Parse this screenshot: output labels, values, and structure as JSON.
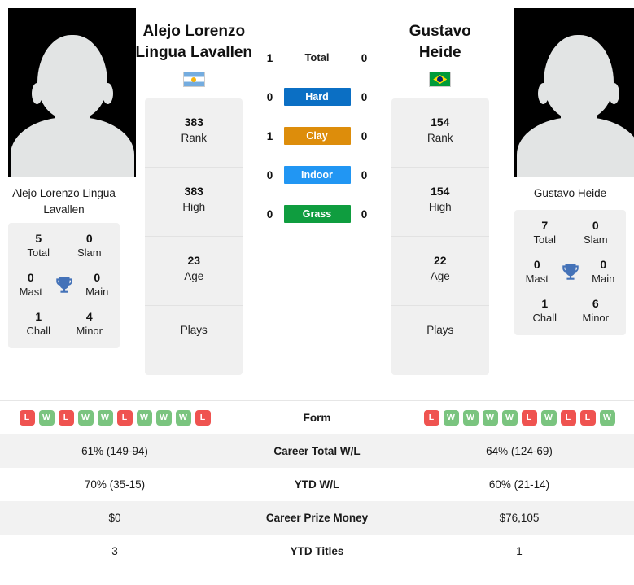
{
  "players": {
    "left": {
      "display_name": "Alejo Lorenzo\nLingua Lavallen",
      "name_line1": "Alejo Lorenzo",
      "name_line2": "Lingua Lavallen",
      "caption_name": "Alejo Lorenzo Lingua Lavallen",
      "country": "Argentina",
      "flag_icon": "flag-argentina",
      "avatar_icon": "player-avatar-placeholder",
      "titles": {
        "total_value": "5",
        "total_label": "Total",
        "slam_value": "0",
        "slam_label": "Slam",
        "mast_value": "0",
        "mast_label": "Mast",
        "main_value": "0",
        "main_label": "Main",
        "chall_value": "1",
        "chall_label": "Chall",
        "minor_value": "4",
        "minor_label": "Minor"
      },
      "stats": [
        {
          "value": "383",
          "label": "Rank"
        },
        {
          "value": "383",
          "label": "High"
        },
        {
          "value": "23",
          "label": "Age"
        },
        {
          "value": "",
          "label": "Plays"
        }
      ],
      "form": [
        "L",
        "W",
        "L",
        "W",
        "W",
        "L",
        "W",
        "W",
        "W",
        "L"
      ],
      "career_total_wl": "61% (149-94)",
      "ytd_wl": "70% (35-15)",
      "career_prize_money": "$0",
      "ytd_titles": "3"
    },
    "right": {
      "display_name": "Gustavo\nHeide",
      "name_line1": "Gustavo",
      "name_line2": "Heide",
      "caption_name": "Gustavo Heide",
      "country": "Brazil",
      "flag_icon": "flag-brazil",
      "avatar_icon": "player-avatar-placeholder",
      "titles": {
        "total_value": "7",
        "total_label": "Total",
        "slam_value": "0",
        "slam_label": "Slam",
        "mast_value": "0",
        "mast_label": "Mast",
        "main_value": "0",
        "main_label": "Main",
        "chall_value": "1",
        "chall_label": "Chall",
        "minor_value": "6",
        "minor_label": "Minor"
      },
      "stats": [
        {
          "value": "154",
          "label": "Rank"
        },
        {
          "value": "154",
          "label": "High"
        },
        {
          "value": "22",
          "label": "Age"
        },
        {
          "value": "",
          "label": "Plays"
        }
      ],
      "form": [
        "L",
        "W",
        "W",
        "W",
        "W",
        "L",
        "W",
        "L",
        "L",
        "W"
      ],
      "career_total_wl": "64% (124-69)",
      "ytd_wl": "60% (21-14)",
      "career_prize_money": "$76,105",
      "ytd_titles": "1"
    }
  },
  "head_to_head": [
    {
      "label": "Total",
      "left": "1",
      "right": "0",
      "color": "",
      "style": "plain"
    },
    {
      "label": "Hard",
      "left": "0",
      "right": "0",
      "color": "#0b6fc4",
      "style": "pill"
    },
    {
      "label": "Clay",
      "left": "1",
      "right": "0",
      "color": "#dd8d0b",
      "style": "pill"
    },
    {
      "label": "Indoor",
      "left": "0",
      "right": "0",
      "color": "#2196f3",
      "style": "pill"
    },
    {
      "label": "Grass",
      "left": "0",
      "right": "0",
      "color": "#0f9d3f",
      "style": "pill"
    }
  ],
  "table_rows": [
    {
      "key": "form",
      "label": "Form",
      "left": "",
      "right": ""
    },
    {
      "key": "career",
      "label": "Career Total W/L",
      "left": "61% (149-94)",
      "right": "64% (124-69)"
    },
    {
      "key": "ytd",
      "label": "YTD W/L",
      "left": "70% (35-15)",
      "right": "60% (21-14)"
    },
    {
      "key": "prize",
      "label": "Career Prize Money",
      "left": "$0",
      "right": "$76,105"
    },
    {
      "key": "titles",
      "label": "YTD Titles",
      "left": "3",
      "right": "1"
    }
  ],
  "icons": {
    "trophy": "trophy-icon"
  },
  "colors": {
    "win": "#7ac47f",
    "loss": "#ef5350",
    "hard": "#0b6fc4",
    "clay": "#dd8d0b",
    "indoor": "#2196f3",
    "grass": "#0f9d3f",
    "trophy": "#4472b8",
    "card_bg": "#f0f0f0",
    "row_shade": "#f2f2f2"
  }
}
